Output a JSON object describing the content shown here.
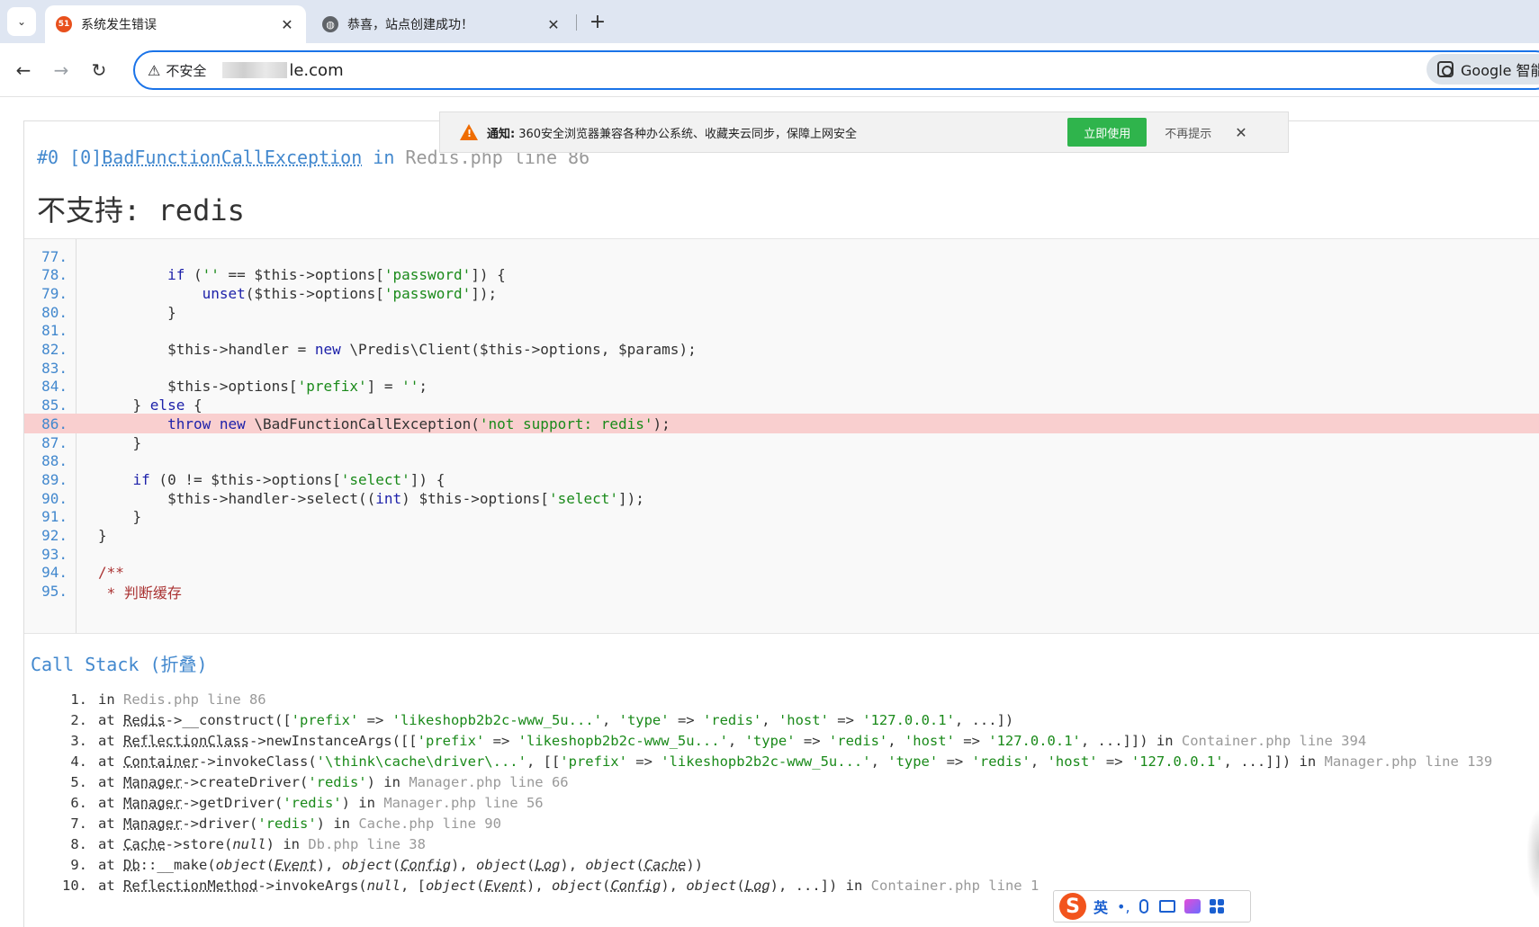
{
  "browser": {
    "tabs": [
      {
        "favicon": "51",
        "title": "系统发生错误"
      },
      {
        "favicon": "globe",
        "title": "恭喜，站点创建成功！"
      }
    ],
    "tab_close": "✕",
    "new_tab": "+",
    "tab_menu": "⌄",
    "nav": {
      "back": "←",
      "forward": "→",
      "reload": "↻"
    },
    "address": {
      "warning_icon": "⚠",
      "security_label": "不安全",
      "url_visible": "le.com"
    },
    "search_pill": "Google 智能"
  },
  "notification": {
    "label": "通知:",
    "text": "360安全浏览器兼容各种办公系统、收藏夹云同步，保障上网安全",
    "primary_button": "立即使用",
    "dismiss": "不再提示",
    "close": "✕",
    "accent": "#2fb44c"
  },
  "error": {
    "index": "#0 [0]",
    "exception_class": "BadFunctionCallException",
    "in_word": "in",
    "location": "Redis.php line 86",
    "message": "不支持: redis"
  },
  "source": {
    "highlight_line": 86,
    "highlight_color": "#f9cfcf",
    "lines": [
      {
        "n": "77.",
        "code": ""
      },
      {
        "n": "78.",
        "code": "        if ('' == $this->options['password']) {"
      },
      {
        "n": "79.",
        "code": "            unset($this->options['password']);"
      },
      {
        "n": "80.",
        "code": "        }"
      },
      {
        "n": "81.",
        "code": ""
      },
      {
        "n": "82.",
        "code": "        $this->handler = new \\Predis\\Client($this->options, $params);"
      },
      {
        "n": "83.",
        "code": ""
      },
      {
        "n": "84.",
        "code": "        $this->options['prefix'] = '';"
      },
      {
        "n": "85.",
        "code": "    } else {"
      },
      {
        "n": "86.",
        "code": "        throw new \\BadFunctionCallException('not support: redis');"
      },
      {
        "n": "87.",
        "code": "    }"
      },
      {
        "n": "88.",
        "code": ""
      },
      {
        "n": "89.",
        "code": "    if (0 != $this->options['select']) {"
      },
      {
        "n": "90.",
        "code": "        $this->handler->select((int) $this->options['select']);"
      },
      {
        "n": "91.",
        "code": "    }"
      },
      {
        "n": "92.",
        "code": "}"
      },
      {
        "n": "93.",
        "code": ""
      },
      {
        "n": "94.",
        "code": "/**"
      },
      {
        "n": "95.",
        "code": " * 判断缓存"
      }
    ]
  },
  "call_stack": {
    "title": "Call Stack (折叠)",
    "rows": [
      {
        "n": "1.",
        "text": "in Redis.php line 86"
      },
      {
        "n": "2.",
        "text": "at Redis->__construct(['prefix' => 'likeshopb2b2c-www_5u...', 'type' => 'redis', 'host' => '127.0.0.1', ...])"
      },
      {
        "n": "3.",
        "text": "at ReflectionClass->newInstanceArgs([['prefix' => 'likeshopb2b2c-www_5u...', 'type' => 'redis', 'host' => '127.0.0.1', ...]]) in Container.php line 394"
      },
      {
        "n": "4.",
        "text": "at Container->invokeClass('\\think\\cache\\driver\\...', [['prefix' => 'likeshopb2b2c-www_5u...', 'type' => 'redis', 'host' => '127.0.0.1', ...]]) in Manager.php line 139"
      },
      {
        "n": "5.",
        "text": "at Manager->createDriver('redis') in Manager.php line 66"
      },
      {
        "n": "6.",
        "text": "at Manager->getDriver('redis') in Manager.php line 56"
      },
      {
        "n": "7.",
        "text": "at Manager->driver('redis') in Cache.php line 90"
      },
      {
        "n": "8.",
        "text": "at Cache->store(null) in Db.php line 38"
      },
      {
        "n": "9.",
        "text": "at Db::__make(object(Event), object(Config), object(Log), object(Cache))"
      },
      {
        "n": "10.",
        "text": "at ReflectionMethod->invokeArgs(null, [object(Event), object(Config), object(Log), ...]) in Container.php line 1"
      }
    ]
  },
  "ime": {
    "logo": "S",
    "lang": "英",
    "punct": "•,"
  },
  "colors": {
    "link_blue": "#4288ce",
    "focus_blue": "#1a73e8",
    "string_green": "#1a8a1a"
  }
}
